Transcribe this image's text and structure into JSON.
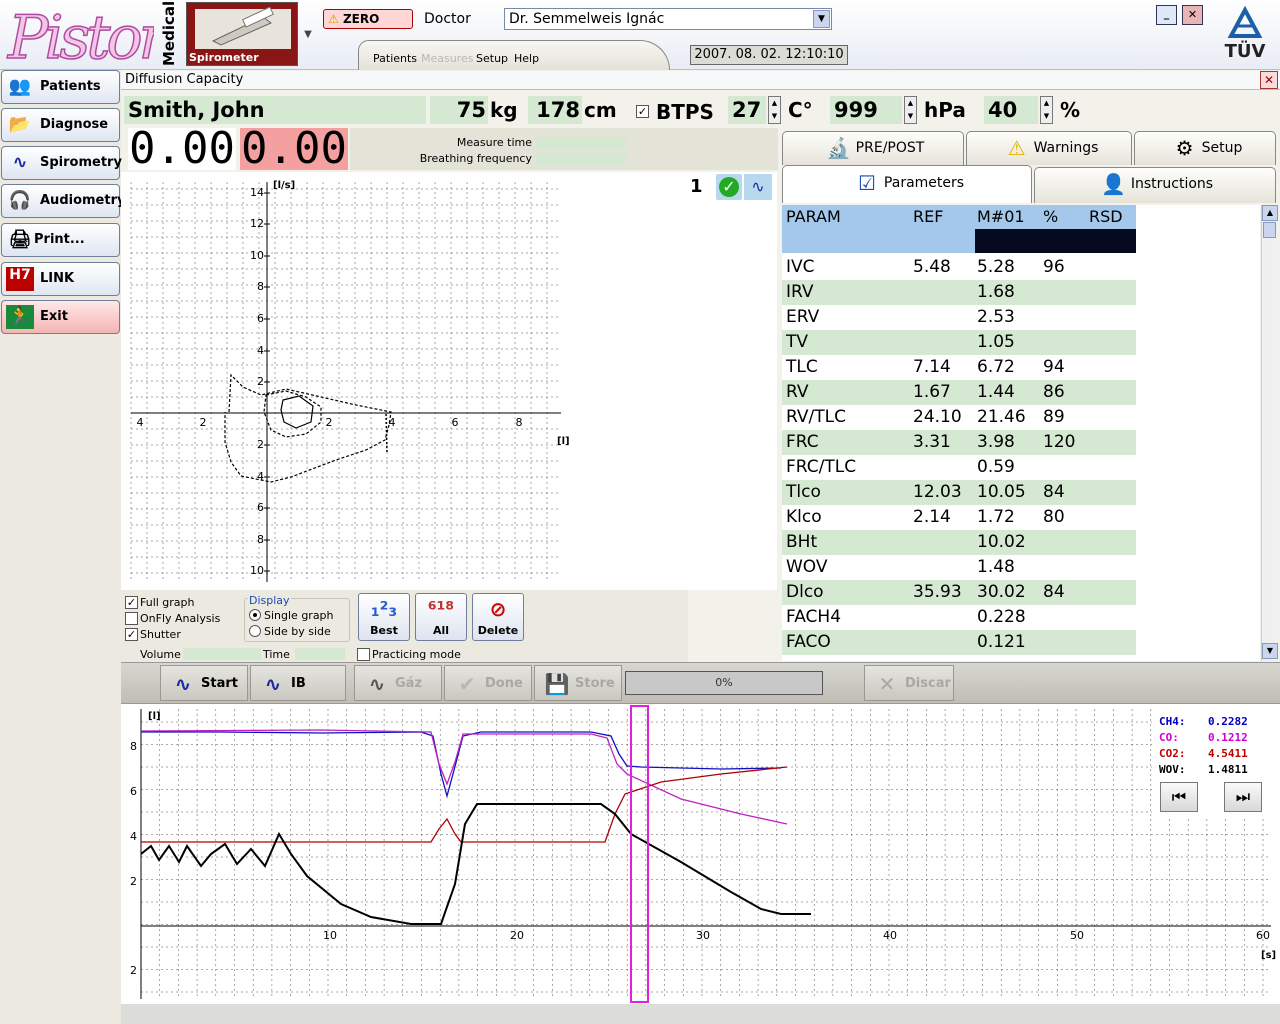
{
  "app": {
    "logo_text": "Piston",
    "medical_label": "Medical",
    "module_name": "Spirometer",
    "zero_label": "ZERO",
    "doctor_label": "Doctor",
    "doctor_value": "Dr. Semmelweis Ignác",
    "menu": [
      "Patients",
      "Measures",
      "Setup",
      "Help"
    ],
    "datetime": "2007. 08. 02. 12:10:10",
    "brand": "TÜV"
  },
  "sidebar": {
    "items": [
      {
        "label": "Patients",
        "icon": "patients-icon"
      },
      {
        "label": "Diagnose",
        "icon": "folder-icon"
      },
      {
        "label": "Spirometry",
        "icon": "wave-icon"
      },
      {
        "label": "Audiometry",
        "icon": "headphones-icon"
      },
      {
        "label": "Print...",
        "icon": "printer-icon"
      },
      {
        "label": "LINK",
        "icon": "hl7-icon"
      },
      {
        "label": "Exit",
        "icon": "exit-icon"
      }
    ]
  },
  "window": {
    "title": "Diffusion Capacity"
  },
  "patient": {
    "name": "Smith, John",
    "weight": "75",
    "weight_unit": "kg",
    "height": "178",
    "height_unit": "cm",
    "btps_label": "BTPS",
    "temperature": "27",
    "temperature_unit": "C°",
    "pressure": "999",
    "pressure_unit": "hPa",
    "humidity": "40",
    "humidity_unit": "%"
  },
  "readouts": {
    "value1": "0.00",
    "value2": "0.00",
    "measure_time_label": "Measure time",
    "breathing_frequency_label": "Breathing frequency"
  },
  "flow_volume_graph": {
    "y_unit": "[l/s]",
    "x_unit": "[l]",
    "y_ticks": [
      "14",
      "12",
      "10",
      "8",
      "6",
      "4",
      "2",
      "2",
      "4",
      "6",
      "8",
      "10"
    ],
    "x_ticks": [
      "4",
      "2",
      "2",
      "4",
      "6",
      "8"
    ],
    "record_number": "1"
  },
  "controls": {
    "full_graph": "Full graph",
    "onfly": "OnFly Analysis",
    "shutter": "Shutter",
    "display_label": "Display",
    "single_graph": "Single graph",
    "side_by_side": "Side by side",
    "volume_label": "Volume",
    "time_label": "Time",
    "practicing": "Practicing mode",
    "best": "Best",
    "all": "All",
    "delete": "Delete",
    "full_graph_checked": true,
    "onfly_checked": false,
    "shutter_checked": true,
    "single_graph_selected": true,
    "practicing_checked": false
  },
  "tabs": {
    "pre_post": "PRE/POST",
    "warnings": "Warnings",
    "setup": "Setup",
    "parameters": "Parameters",
    "instructions": "Instructions"
  },
  "table": {
    "headers": [
      "PARAM",
      "REF",
      "M#01",
      "%",
      "RSD"
    ],
    "rows": [
      [
        "IVC",
        "5.48",
        "5.28",
        "96",
        ""
      ],
      [
        "IRV",
        "",
        "1.68",
        "",
        ""
      ],
      [
        "ERV",
        "",
        "2.53",
        "",
        ""
      ],
      [
        "TV",
        "",
        "1.05",
        "",
        ""
      ],
      [
        "TLC",
        "7.14",
        "6.72",
        "94",
        ""
      ],
      [
        "RV",
        "1.67",
        "1.44",
        "86",
        ""
      ],
      [
        "RV/TLC",
        "24.10",
        "21.46",
        "89",
        ""
      ],
      [
        "FRC",
        "3.31",
        "3.98",
        "120",
        ""
      ],
      [
        "FRC/TLC",
        "",
        "0.59",
        "",
        ""
      ],
      [
        "Tlco",
        "12.03",
        "10.05",
        "84",
        ""
      ],
      [
        "Klco",
        "2.14",
        "1.72",
        "80",
        ""
      ],
      [
        "BHt",
        "",
        "10.02",
        "",
        ""
      ],
      [
        "WOV",
        "",
        "1.48",
        "",
        ""
      ],
      [
        "Dlco",
        "35.93",
        "30.02",
        "84",
        ""
      ],
      [
        "FACH4",
        "",
        "0.228",
        "",
        ""
      ],
      [
        "FACO",
        "",
        "0.121",
        "",
        ""
      ]
    ]
  },
  "toolbar": {
    "start": "Start",
    "ib_start": "IB Start",
    "gaz": "Gáz",
    "done": "Done",
    "store": "Store",
    "progress": "0%",
    "progress_value": 0,
    "discard": "Discar"
  },
  "time_graph": {
    "y_unit": "[l]",
    "x_unit": "[s]",
    "y_ticks": [
      "8",
      "6",
      "4",
      "2",
      "2"
    ],
    "x_ticks": [
      "10",
      "20",
      "30",
      "40",
      "50",
      "60"
    ]
  },
  "legend": [
    {
      "label": "CH4:",
      "value": "0.2282",
      "color": "#0000c0"
    },
    {
      "label": "CO:",
      "value": "0.1212",
      "color": "#d000d0"
    },
    {
      "label": "CO2:",
      "value": "4.5411",
      "color": "#c00000"
    },
    {
      "label": "WOV:",
      "value": "1.4811",
      "color": "#000000"
    }
  ],
  "colors": {
    "field_green": "#d4e8d2",
    "row_green": "#d4e8d2",
    "table_header": "#a4c8ec",
    "red_readout": "#f4a0a0",
    "marker": "#e020e0"
  }
}
